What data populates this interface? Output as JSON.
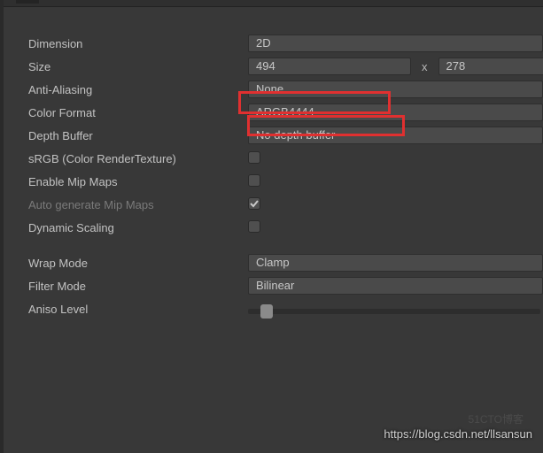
{
  "props": {
    "dimension": {
      "label": "Dimension",
      "value": "2D"
    },
    "size": {
      "label": "Size",
      "width": "494",
      "height": "278",
      "separator": "x"
    },
    "antiAliasing": {
      "label": "Anti-Aliasing",
      "value": "None"
    },
    "colorFormat": {
      "label": "Color Format",
      "value": "ARGB4444"
    },
    "depthBuffer": {
      "label": "Depth Buffer",
      "value": "No depth buffer"
    },
    "srgb": {
      "label": "sRGB (Color RenderTexture)",
      "checked": false
    },
    "mipMaps": {
      "label": "Enable Mip Maps",
      "checked": false
    },
    "autoMip": {
      "label": "Auto generate Mip Maps",
      "checked": true
    },
    "dynamicScaling": {
      "label": "Dynamic Scaling",
      "checked": false
    },
    "wrapMode": {
      "label": "Wrap Mode",
      "value": "Clamp"
    },
    "filterMode": {
      "label": "Filter Mode",
      "value": "Bilinear"
    },
    "anisoLevel": {
      "label": "Aniso Level"
    }
  },
  "watermark": {
    "url": "https://blog.csdn.net/llsansun",
    "faint": "51CTO博客"
  }
}
